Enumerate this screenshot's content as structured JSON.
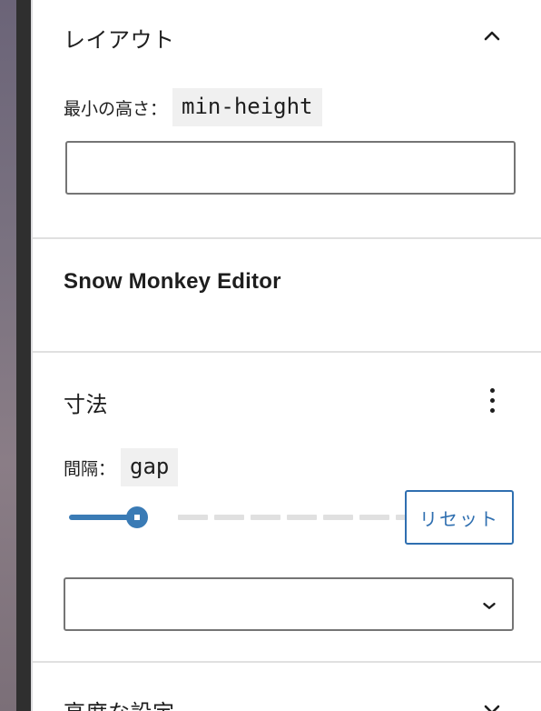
{
  "layout_panel": {
    "title": "レイアウト",
    "min_height_label": "最小の高さ：",
    "min_height_code": "min-height",
    "min_height_value": "",
    "toggle_icon": "chevron-up-icon"
  },
  "snow_monkey_panel": {
    "title": "Snow Monkey Editor"
  },
  "dimensions_panel": {
    "title": "寸法",
    "menu_icon": "more-vertical-icon",
    "gap_label": "間隔：",
    "gap_code": "gap",
    "gap_slider_fraction": 0.2,
    "reset_label": "リセット",
    "select_value": "",
    "select_icon": "chevron-down-icon"
  },
  "advanced_panel": {
    "title": "高度な設定",
    "toggle_icon": "chevron-down-icon"
  },
  "colors": {
    "accent": "#3a7bb5",
    "button_border": "#2f6fb0",
    "text": "#1e1e1e",
    "divider": "#e0e0e0"
  }
}
